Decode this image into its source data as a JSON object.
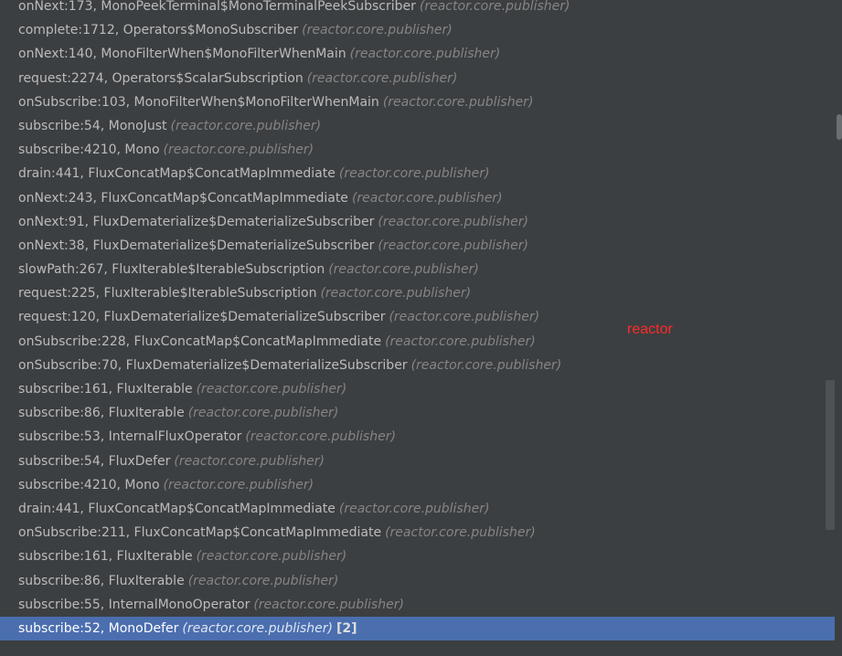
{
  "frames": [
    {
      "method": "onNext:173, MonoPeekTerminal$MonoTerminalPeekSubscriber",
      "package": "(reactor.core.publisher)"
    },
    {
      "method": "complete:1712, Operators$MonoSubscriber",
      "package": "(reactor.core.publisher)"
    },
    {
      "method": "onNext:140, MonoFilterWhen$MonoFilterWhenMain",
      "package": "(reactor.core.publisher)"
    },
    {
      "method": "request:2274, Operators$ScalarSubscription",
      "package": "(reactor.core.publisher)"
    },
    {
      "method": "onSubscribe:103, MonoFilterWhen$MonoFilterWhenMain",
      "package": "(reactor.core.publisher)"
    },
    {
      "method": "subscribe:54, MonoJust",
      "package": "(reactor.core.publisher)"
    },
    {
      "method": "subscribe:4210, Mono",
      "package": "(reactor.core.publisher)"
    },
    {
      "method": "drain:441, FluxConcatMap$ConcatMapImmediate",
      "package": "(reactor.core.publisher)"
    },
    {
      "method": "onNext:243, FluxConcatMap$ConcatMapImmediate",
      "package": "(reactor.core.publisher)"
    },
    {
      "method": "onNext:91, FluxDematerialize$DematerializeSubscriber",
      "package": "(reactor.core.publisher)"
    },
    {
      "method": "onNext:38, FluxDematerialize$DematerializeSubscriber",
      "package": "(reactor.core.publisher)"
    },
    {
      "method": "slowPath:267, FluxIterable$IterableSubscription",
      "package": "(reactor.core.publisher)"
    },
    {
      "method": "request:225, FluxIterable$IterableSubscription",
      "package": "(reactor.core.publisher)"
    },
    {
      "method": "request:120, FluxDematerialize$DematerializeSubscriber",
      "package": "(reactor.core.publisher)"
    },
    {
      "method": "onSubscribe:228, FluxConcatMap$ConcatMapImmediate",
      "package": "(reactor.core.publisher)"
    },
    {
      "method": "onSubscribe:70, FluxDematerialize$DematerializeSubscriber",
      "package": "(reactor.core.publisher)"
    },
    {
      "method": "subscribe:161, FluxIterable",
      "package": "(reactor.core.publisher)"
    },
    {
      "method": "subscribe:86, FluxIterable",
      "package": "(reactor.core.publisher)"
    },
    {
      "method": "subscribe:53, InternalFluxOperator",
      "package": "(reactor.core.publisher)"
    },
    {
      "method": "subscribe:54, FluxDefer",
      "package": "(reactor.core.publisher)"
    },
    {
      "method": "subscribe:4210, Mono",
      "package": "(reactor.core.publisher)"
    },
    {
      "method": "drain:441, FluxConcatMap$ConcatMapImmediate",
      "package": "(reactor.core.publisher)"
    },
    {
      "method": "onSubscribe:211, FluxConcatMap$ConcatMapImmediate",
      "package": "(reactor.core.publisher)"
    },
    {
      "method": "subscribe:161, FluxIterable",
      "package": "(reactor.core.publisher)"
    },
    {
      "method": "subscribe:86, FluxIterable",
      "package": "(reactor.core.publisher)"
    },
    {
      "method": "subscribe:55, InternalMonoOperator",
      "package": "(reactor.core.publisher)"
    }
  ],
  "selected_frame": {
    "method": "subscribe:52, MonoDefer",
    "package": "(reactor.core.publisher)",
    "count": "[2]"
  },
  "annotation": {
    "text": "reactor",
    "color": "#ff2a2a"
  },
  "colors": {
    "background": "#3c3f41",
    "selection": "#4b6eaf",
    "text": "#bbbbbb",
    "package_text": "#858585"
  }
}
